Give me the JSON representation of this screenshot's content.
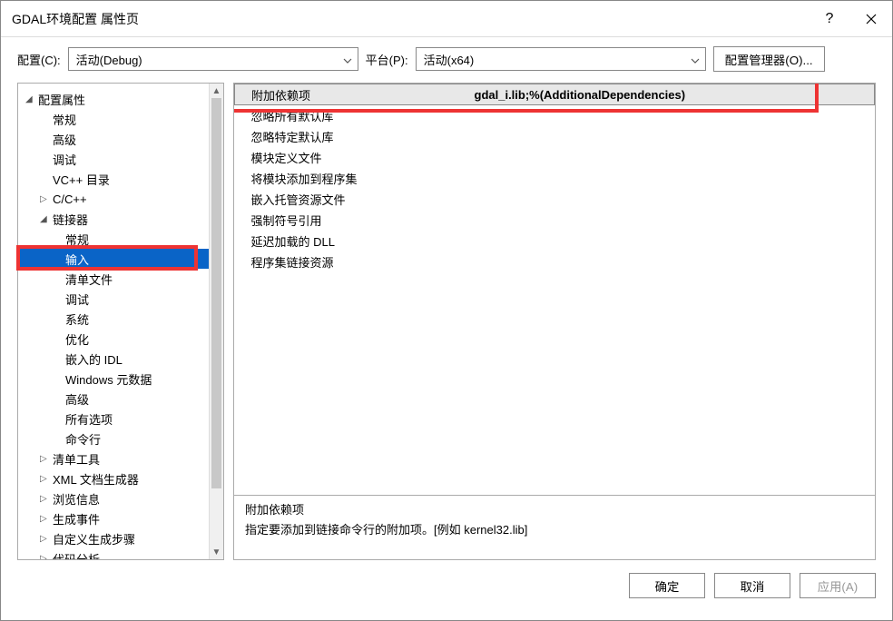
{
  "window": {
    "title": "GDAL环境配置 属性页"
  },
  "toolbar": {
    "config_label": "配置(C):",
    "config_value": "活动(Debug)",
    "platform_label": "平台(P):",
    "platform_value": "活动(x64)",
    "manager_button": "配置管理器(O)..."
  },
  "tree": {
    "root": "配置属性",
    "items": {
      "general": "常规",
      "advanced": "高级",
      "debug": "调试",
      "vcdirs": "VC++ 目录",
      "ccpp": "C/C++",
      "linker": "链接器",
      "l_general": "常规",
      "l_input": "输入",
      "l_manifest": "清单文件",
      "l_debug": "调试",
      "l_system": "系统",
      "l_opt": "优化",
      "l_idl": "嵌入的 IDL",
      "l_winmd": "Windows 元数据",
      "l_advanced": "高级",
      "l_all": "所有选项",
      "l_cmd": "命令行",
      "manifest_tool": "清单工具",
      "xml_doc": "XML 文档生成器",
      "browse": "浏览信息",
      "build_events": "生成事件",
      "custom_build": "自定义生成步骤",
      "code_analysis": "代码分析"
    }
  },
  "grid": {
    "rows": [
      {
        "name": "附加依赖项",
        "value": "gdal_i.lib;%(AdditionalDependencies)"
      },
      {
        "name": "忽略所有默认库",
        "value": ""
      },
      {
        "name": "忽略特定默认库",
        "value": ""
      },
      {
        "name": "模块定义文件",
        "value": ""
      },
      {
        "name": "将模块添加到程序集",
        "value": ""
      },
      {
        "name": "嵌入托管资源文件",
        "value": ""
      },
      {
        "name": "强制符号引用",
        "value": ""
      },
      {
        "name": "延迟加载的 DLL",
        "value": ""
      },
      {
        "name": "程序集链接资源",
        "value": ""
      }
    ]
  },
  "description": {
    "title": "附加依赖项",
    "body": "指定要添加到链接命令行的附加项。[例如 kernel32.lib]"
  },
  "footer": {
    "ok": "确定",
    "cancel": "取消",
    "apply": "应用(A)"
  }
}
